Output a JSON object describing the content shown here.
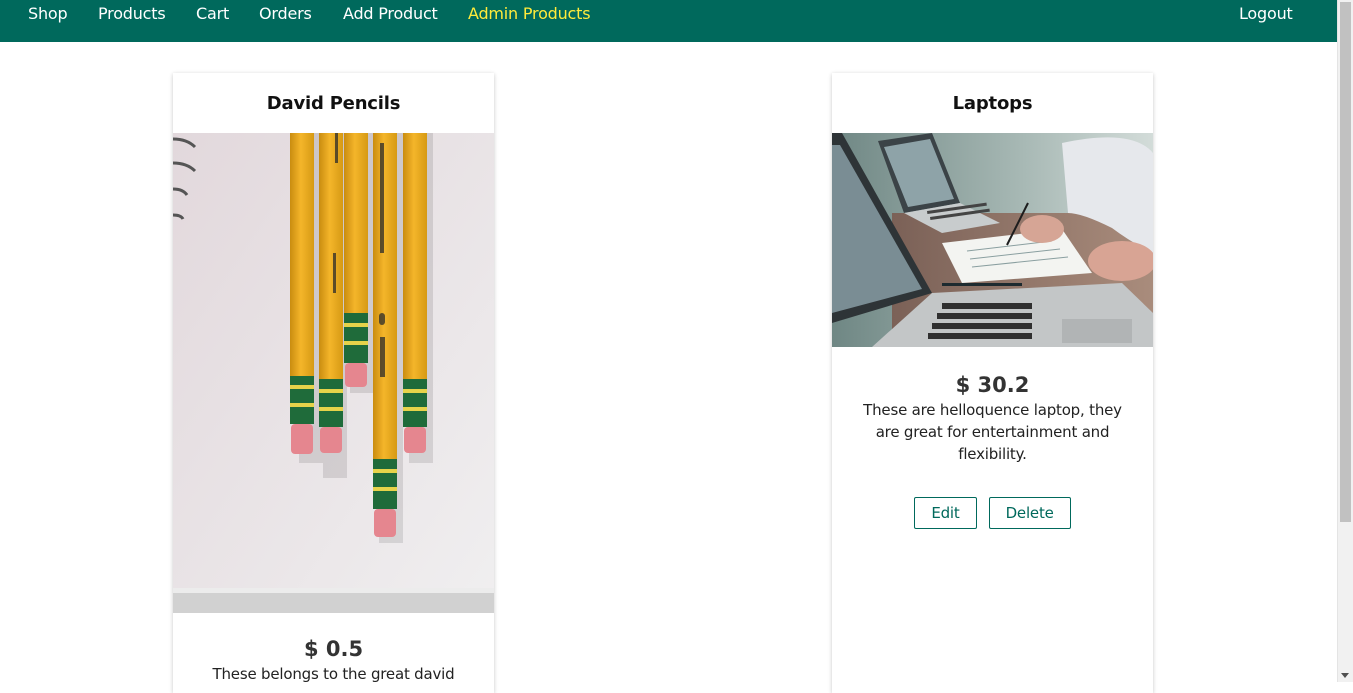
{
  "nav": {
    "shop": "Shop",
    "products": "Products",
    "cart": "Cart",
    "orders": "Orders",
    "add_product": "Add Product",
    "admin_products": "Admin Products",
    "logout": "Logout"
  },
  "colors": {
    "header_bg": "#00695c",
    "active_nav": "#ffeb3b",
    "accent": "#00695c"
  },
  "products": [
    {
      "title": "David Pencils",
      "price": "$ 0.5",
      "description": "These belongs to the great david"
    },
    {
      "title": "Laptops",
      "price": "$ 30.2",
      "description": "These are helloquence laptop, they are great for entertainment and flexibility.",
      "edit_label": "Edit",
      "delete_label": "Delete"
    }
  ]
}
